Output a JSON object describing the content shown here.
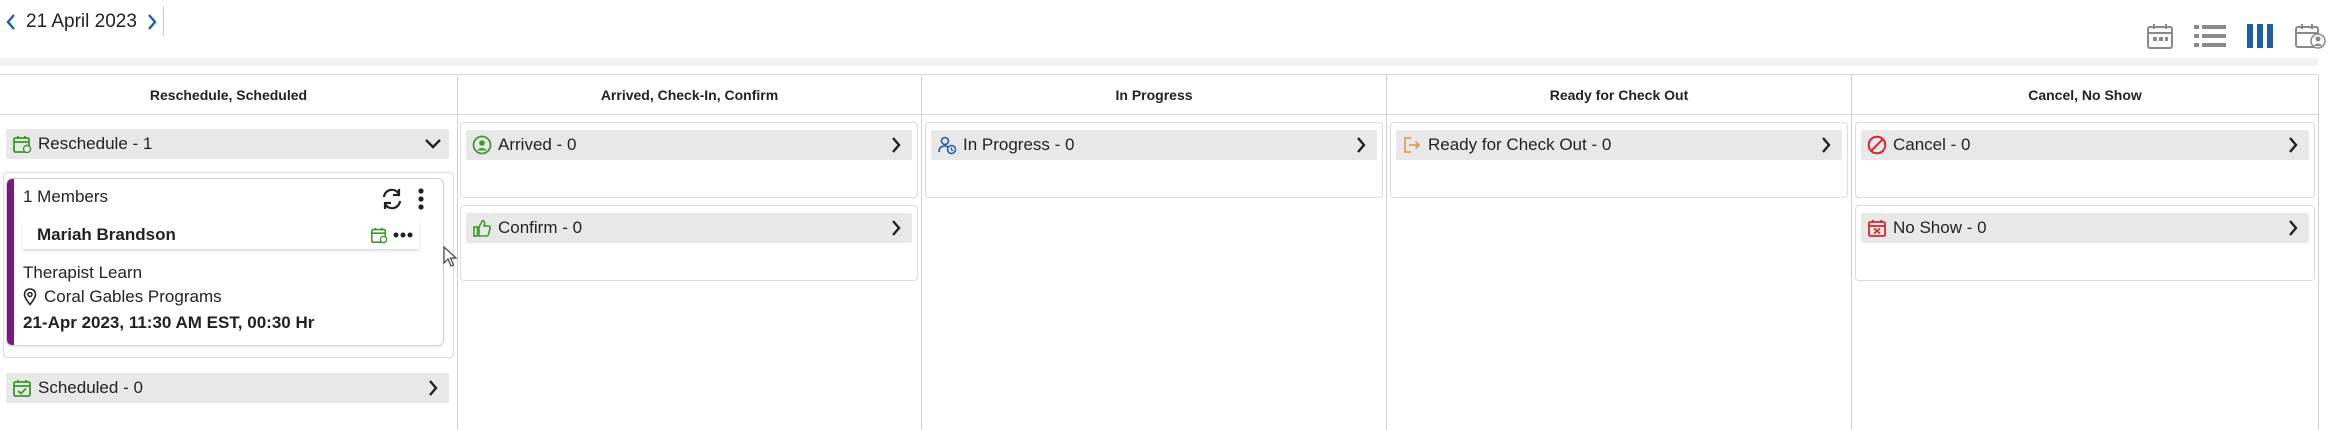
{
  "header": {
    "date": "21 April 2023",
    "view_icons": [
      "calendar-day-icon",
      "list-view-icon",
      "board-view-icon",
      "calendar-user-icon"
    ]
  },
  "colors": {
    "accent_blue": "#1f5fa8",
    "green": "#3a9a2a",
    "red": "#d9262c",
    "orange": "#e39a54",
    "card_accent": "#7a1a7e",
    "bar_grey": "#e8e8e8"
  },
  "columns": [
    {
      "title": "Reschedule, Scheduled",
      "groups": [
        {
          "label": "Reschedule - 1",
          "icon": "calendar-refresh-icon",
          "expanded": true
        },
        {
          "label": "Scheduled - 0",
          "icon": "calendar-check-icon",
          "expanded": false
        }
      ]
    },
    {
      "title": "Arrived, Check-In, Confirm",
      "groups": [
        {
          "label": "Arrived - 0",
          "icon": "user-check-icon"
        },
        {
          "label": "Confirm - 0",
          "icon": "thumbs-up-icon"
        }
      ]
    },
    {
      "title": "In Progress",
      "groups": [
        {
          "label": "In Progress - 0",
          "icon": "user-progress-icon"
        }
      ]
    },
    {
      "title": "Ready for Check Out",
      "groups": [
        {
          "label": "Ready for Check Out - 0",
          "icon": "exit-icon"
        }
      ]
    },
    {
      "title": "Cancel, No Show",
      "groups": [
        {
          "label": "Cancel - 0",
          "icon": "ban-icon"
        },
        {
          "label": "No Show - 0",
          "icon": "calendar-x-icon"
        }
      ]
    }
  ],
  "card": {
    "members": "1 Members",
    "member_name": "Mariah Brandson",
    "service": "Therapist Learn",
    "location": "Coral Gables Programs",
    "time": "21-Apr 2023, 11:30 AM EST, 00:30 Hr"
  }
}
